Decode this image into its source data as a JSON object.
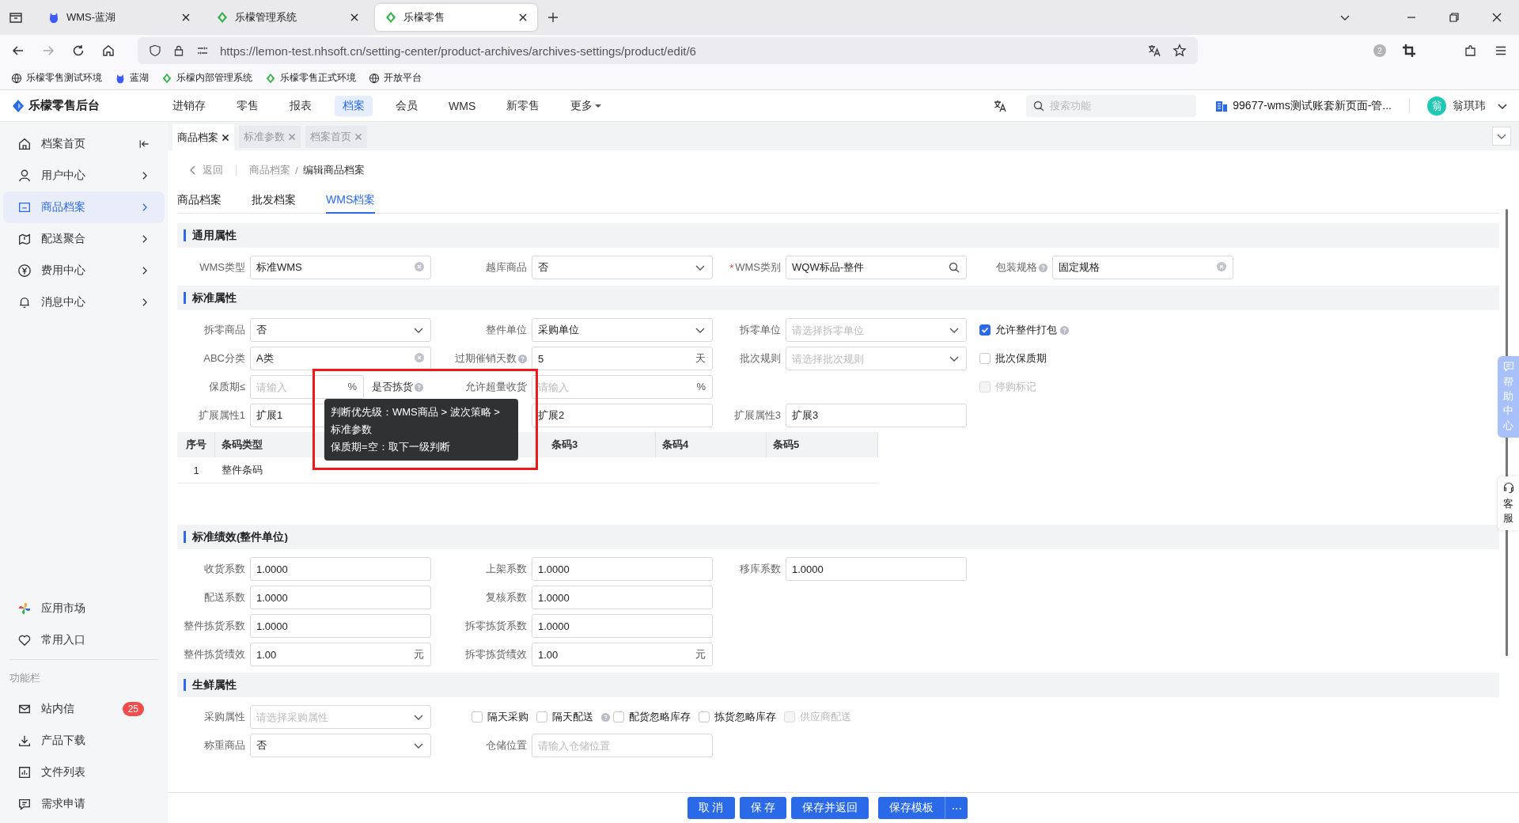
{
  "browser": {
    "tabs": [
      {
        "title": "WMS-蓝湖",
        "selected": false
      },
      {
        "title": "乐檬管理系统",
        "selected": false
      },
      {
        "title": "乐檬零售",
        "selected": true
      }
    ],
    "url": "https://lemon-test.nhsoft.cn/setting-center/product-archives/archives-settings/product/edit/6",
    "extension_badge": "2",
    "bookmarks": [
      "乐檬零售测试环境",
      "蓝湖",
      "乐檬内部管理系统",
      "乐檬零售正式环境",
      "开放平台"
    ]
  },
  "app": {
    "logo": "乐檬零售后台",
    "nav": [
      {
        "label": "进销存",
        "selected": false
      },
      {
        "label": "零售",
        "selected": false
      },
      {
        "label": "报表",
        "selected": false
      },
      {
        "label": "档案",
        "selected": true
      },
      {
        "label": "会员",
        "selected": false
      },
      {
        "label": "WMS",
        "selected": false
      },
      {
        "label": "新零售",
        "selected": false
      },
      {
        "label": "更多",
        "selected": false,
        "dropdown": true
      }
    ],
    "search": {
      "placeholder": "搜索功能"
    },
    "account": "99677-wms测试账套新页面-管...",
    "user": {
      "avatar": "翁",
      "name": "翁琪玮"
    }
  },
  "sidebar": {
    "items": [
      {
        "label": "档案首页",
        "selected": false
      },
      {
        "label": "用户中心",
        "selected": false
      },
      {
        "label": "商品档案",
        "selected": true
      },
      {
        "label": "配送聚合",
        "selected": false
      },
      {
        "label": "费用中心",
        "selected": false
      },
      {
        "label": "消息中心",
        "selected": false
      }
    ],
    "shortcuts": [
      "应用市场",
      "常用入口"
    ],
    "section_label": "功能栏",
    "tools": [
      {
        "label": "站内信",
        "badge": "25"
      },
      {
        "label": "产品下载"
      },
      {
        "label": "文件列表"
      },
      {
        "label": "需求申请"
      }
    ]
  },
  "page_tabs": [
    {
      "label": "商品档案",
      "selected": true
    },
    {
      "label": "标准参数",
      "selected": false
    },
    {
      "label": "档案首页",
      "selected": false
    }
  ],
  "breadcrumb": {
    "back": "返回",
    "items": [
      "商品档案",
      "编辑商品档案"
    ],
    "separator": "/"
  },
  "sub_tabs": [
    {
      "label": "商品档案",
      "selected": false
    },
    {
      "label": "批发档案",
      "selected": false
    },
    {
      "label": "WMS档案",
      "selected": true
    }
  ],
  "sections": [
    {
      "title": "通用属性",
      "rows": [
        [
          {
            "label": "WMS类型",
            "kind": "clear",
            "value": "标准WMS"
          },
          {
            "label": "越库商品",
            "kind": "select",
            "value": "否"
          },
          {
            "label": "WMS类别",
            "kind": "search",
            "value": "WQW标品-整件",
            "required_mark": "*"
          },
          {
            "label": "包装规格",
            "kind": "clear",
            "value": "固定规格",
            "help": true
          }
        ]
      ]
    },
    {
      "title": "标准属性",
      "rows": [
        [
          {
            "label": "拆零商品",
            "kind": "select",
            "value": "否"
          },
          {
            "label": "整件单位",
            "kind": "select",
            "value": "采购单位"
          },
          {
            "label": "拆零单位",
            "kind": "select",
            "placeholder": "请选择拆零单位"
          },
          {
            "label": "允许整件打包",
            "kind": "checkbox",
            "checked": true,
            "disabled": false,
            "help": true
          }
        ],
        [
          {
            "label": "ABC分类",
            "kind": "clear",
            "value": "A类"
          },
          {
            "label": "过期催销天数",
            "kind": "input",
            "value": "5",
            "suffix": "天",
            "help": true
          },
          {
            "label": "批次规则",
            "kind": "select",
            "placeholder": "请选择批次规则"
          },
          {
            "label": "批次保质期",
            "kind": "checkbox",
            "checked": false,
            "disabled": false
          }
        ],
        [
          {
            "label": "保质期≤",
            "kind": "input",
            "placeholder": "请输入",
            "suffix": "%",
            "attached": {
              "label": "是否拣货",
              "help": true
            }
          },
          {
            "label": "允许超量收货",
            "kind": "input",
            "placeholder": "请输入",
            "suffix": "%"
          },
          "",
          {
            "label": "停购标记",
            "kind": "checkbox",
            "checked": false,
            "disabled": true
          }
        ],
        [
          {
            "label": "扩展属性1",
            "kind": "input",
            "value": "扩展1"
          },
          {
            "kind": "input",
            "value": "扩展2"
          },
          {
            "label": "扩展属性3",
            "kind": "input",
            "value": "扩展3"
          }
        ]
      ],
      "table": {
        "columns": [
          "序号",
          "条码类型",
          "条码3",
          "条码4",
          "条码5"
        ],
        "rows": [
          [
            "1",
            "整件条码"
          ]
        ]
      }
    },
    {
      "title": "标准绩效(整件单位)",
      "rows": [
        [
          {
            "label": "收货系数",
            "kind": "input",
            "value": "1.0000"
          },
          {
            "label": "上架系数",
            "kind": "input",
            "value": "1.0000"
          },
          {
            "label": "移库系数",
            "kind": "input",
            "value": "1.0000"
          }
        ],
        [
          {
            "label": "配送系数",
            "kind": "input",
            "value": "1.0000"
          },
          {
            "label": "复核系数",
            "kind": "input",
            "value": "1.0000"
          }
        ],
        [
          {
            "label": "整件拣货系数",
            "kind": "input",
            "value": "1.0000"
          },
          {
            "label": "拆零拣货系数",
            "kind": "input",
            "value": "1.0000"
          }
        ],
        [
          {
            "label": "整件拣货绩效",
            "kind": "input",
            "value": "1.00",
            "suffix": "元"
          },
          {
            "label": "拆零拣货绩效",
            "kind": "input",
            "value": "1.00",
            "suffix": "元"
          }
        ]
      ]
    },
    {
      "title": "生鲜属性",
      "rows": [
        [
          {
            "label": "采购属性",
            "kind": "select",
            "placeholder": "请选择采购属性"
          },
          {
            "kind": "checkgroup",
            "items": [
              {
                "label": "隔天采购",
                "checked": false,
                "disabled": false
              },
              {
                "label": "隔天配送",
                "checked": false,
                "disabled": false,
                "help": true
              },
              {
                "label": "配货忽略库存",
                "checked": false,
                "disabled": false
              },
              {
                "label": "拣货忽略库存",
                "checked": false,
                "disabled": false
              },
              {
                "label": "供应商配送",
                "checked": false,
                "disabled": true
              }
            ]
          }
        ],
        [
          {
            "label": "称重商品",
            "kind": "select",
            "value": "否"
          },
          {
            "label": "仓储位置",
            "kind": "input",
            "placeholder": "请输入仓储位置"
          }
        ]
      ]
    }
  ],
  "tooltip": {
    "lines": [
      "判断优先级：WMS商品 > 波次策略 > 标准参数",
      "保质期=空：取下一级判断"
    ]
  },
  "footer_buttons": [
    {
      "label": "取 消",
      "kind": "plain"
    },
    {
      "label": "保 存",
      "kind": "plain"
    },
    {
      "label": "保存并返回",
      "kind": "plain"
    },
    {
      "label": "保存模板",
      "kind": "split"
    },
    {
      "label": "⋯",
      "kind": "more"
    }
  ],
  "side_tabs": [
    {
      "label": "帮助中心",
      "kind": "help"
    },
    {
      "label": "客服",
      "kind": "service"
    }
  ]
}
